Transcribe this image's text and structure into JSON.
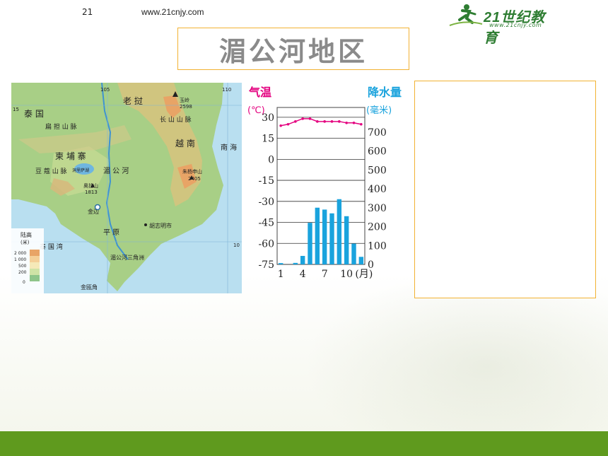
{
  "header": {
    "slide_number": "21",
    "url": "www.21cnjy.com",
    "logo_text": "21世纪教育",
    "logo_sub": "www.21cnjy.com"
  },
  "title": "湄公河地区",
  "map": {
    "countries": {
      "laos": "老 挝",
      "thailand": "泰 国",
      "cambodia": "柬 埔 寨",
      "vietnam": "越 南"
    },
    "labels": {
      "mekong_river": "湄 公 河",
      "dangrek": "扁 担 山 脉",
      "cardamom": "豆 蔻 山 脉",
      "changshan": "长 山 山 脉",
      "plain": "平 原",
      "delta": "湄公河三角洲",
      "sea_south": "南 海",
      "gulf": "泰 国 湾",
      "phnom_penh": "金边",
      "hcmc": "胡志明市",
      "cape": "金瓯角",
      "yu_ling": "玉岭",
      "yu_ling_elev": "2598",
      "aoral": "奥拉山",
      "aoral_elev": "1813",
      "lang_biang": "朱杨申山",
      "lang_biang_elev": "2405",
      "lake": "洞里萨湖"
    },
    "grid": {
      "lon105": "105",
      "lon110": "110",
      "lat15": "15",
      "lat10": "10"
    },
    "legend": {
      "title": "陆高",
      "unit": "(米)",
      "levels": [
        "2 000",
        "1 000",
        "500",
        "200",
        "0"
      ],
      "colors": [
        "#e8a466",
        "#f4cf97",
        "#f5e9b8",
        "#cfe3a6",
        "#8ec58a"
      ]
    }
  },
  "chart_data": {
    "type": "bar",
    "title_left": "气温",
    "unit_left": "(℃)",
    "title_right": "降水量",
    "unit_right": "(毫米)",
    "x_tick_labels": [
      "1",
      "4",
      "7",
      "10",
      "(月)"
    ],
    "x_tick_months": [
      1,
      4,
      7,
      10
    ],
    "temp_ticks": [
      "30",
      "15",
      "0",
      "-15",
      "-30",
      "-45",
      "-60",
      "-75"
    ],
    "temp_tick_values": [
      30,
      15,
      0,
      -15,
      -30,
      -45,
      -60,
      -75
    ],
    "precip_ticks": [
      "700",
      "600",
      "500",
      "400",
      "300",
      "200",
      "100",
      "0"
    ],
    "precip_tick_values": [
      700,
      600,
      500,
      400,
      300,
      200,
      100,
      0
    ],
    "temp_range": [
      -75,
      37
    ],
    "precip_range": [
      0,
      830
    ],
    "temperature": [
      24,
      25,
      27,
      29,
      29,
      27,
      27,
      27,
      27,
      26,
      26,
      25
    ],
    "precipitation": [
      7,
      0,
      8,
      45,
      220,
      300,
      290,
      270,
      345,
      255,
      110,
      40
    ],
    "temp_color": "#e4007f",
    "precip_color": "#1aa3dd"
  },
  "answer_box": {
    "content": ""
  }
}
